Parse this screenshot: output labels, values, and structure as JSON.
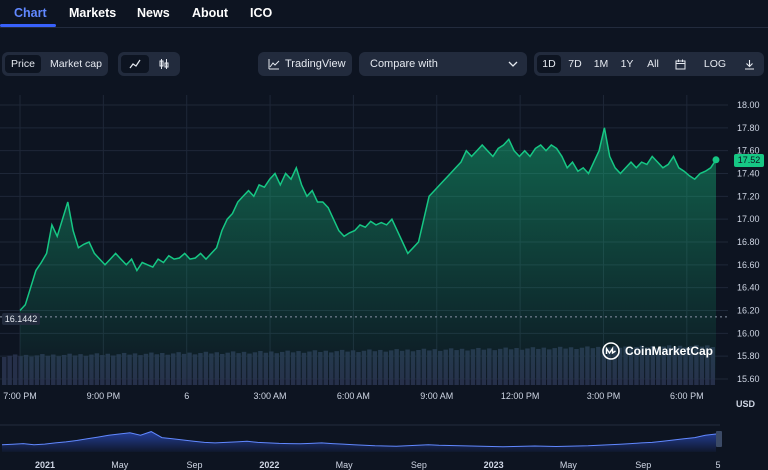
{
  "nav": {
    "tabs": [
      {
        "label": "Chart",
        "active": true
      },
      {
        "label": "Markets",
        "active": false
      },
      {
        "label": "News",
        "active": false
      },
      {
        "label": "About",
        "active": false
      },
      {
        "label": "ICO",
        "active": false
      }
    ]
  },
  "toolbar": {
    "price_label": "Price",
    "marketcap_label": "Market cap",
    "line_chart_icon": "line-chart-icon",
    "candles_icon": "candlestick-icon",
    "tradingview_label": "TradingView",
    "compare_label": "Compare with",
    "ranges": [
      "1D",
      "7D",
      "1M",
      "1Y",
      "All"
    ],
    "selected_range": "1D",
    "calendar_icon": "calendar-icon",
    "log_label": "LOG",
    "download_icon": "download-icon"
  },
  "colors": {
    "background": "#0d1421",
    "accent": "#3861fb",
    "positive": "#16c784",
    "panel": "#222b3d"
  },
  "current_price_badge": "17.52",
  "open_price_badge": "16.1442",
  "watermark": "CoinMarketCap",
  "currency": "USD",
  "chart_data": {
    "type": "line",
    "ylim": [
      15.6,
      18.0
    ],
    "y_ticks": [
      "18.00",
      "17.80",
      "17.60",
      "17.40",
      "17.20",
      "17.00",
      "16.80",
      "16.60",
      "16.40",
      "16.20",
      "16.00",
      "15.80",
      "15.60"
    ],
    "x_ticks": [
      "7:00 PM",
      "9:00 PM",
      "6",
      "3:00 AM",
      "6:00 AM",
      "9:00 AM",
      "12:00 PM",
      "3:00 PM",
      "6:00 PM"
    ],
    "grid": true,
    "reference_line": 16.1442,
    "price": [
      16.2,
      16.25,
      16.4,
      16.55,
      16.62,
      16.7,
      16.95,
      16.85,
      17.0,
      17.15,
      16.9,
      16.75,
      16.78,
      16.8,
      16.7,
      16.65,
      16.6,
      16.65,
      16.7,
      16.65,
      16.6,
      16.65,
      16.55,
      16.62,
      16.6,
      16.58,
      16.65,
      16.62,
      16.68,
      16.65,
      16.66,
      16.7,
      16.65,
      16.66,
      16.7,
      16.65,
      16.7,
      16.75,
      16.9,
      17.0,
      17.05,
      17.15,
      17.2,
      17.25,
      17.2,
      17.3,
      17.28,
      17.35,
      17.4,
      17.3,
      17.4,
      17.35,
      17.45,
      17.3,
      17.2,
      17.25,
      17.15,
      17.15,
      17.1,
      17.0,
      16.9,
      16.85,
      16.88,
      16.9,
      16.95,
      16.93,
      16.98,
      16.95,
      16.97,
      16.95,
      17.0,
      16.9,
      16.8,
      16.7,
      16.75,
      16.8,
      17.0,
      17.2,
      17.25,
      17.3,
      17.35,
      17.4,
      17.45,
      17.5,
      17.6,
      17.55,
      17.6,
      17.65,
      17.6,
      17.55,
      17.62,
      17.65,
      17.7,
      17.6,
      17.55,
      17.6,
      17.55,
      17.62,
      17.65,
      17.6,
      17.65,
      17.62,
      17.55,
      17.45,
      17.5,
      17.42,
      17.45,
      17.4,
      17.5,
      17.6,
      17.8,
      17.55,
      17.45,
      17.4,
      17.45,
      17.5,
      17.45,
      17.5,
      17.48,
      17.55,
      17.5,
      17.45,
      17.48,
      17.55,
      17.45,
      17.42,
      17.38,
      17.35,
      17.4,
      17.42,
      17.45,
      17.52
    ],
    "volume_bars": 131,
    "timeline": {
      "labels": [
        "2021",
        "May",
        "Sep",
        "2022",
        "May",
        "Sep",
        "2023",
        "May",
        "Sep",
        "5"
      ],
      "values": [
        0.3,
        0.32,
        0.35,
        0.3,
        0.33,
        0.38,
        0.42,
        0.48,
        0.55,
        0.62,
        0.7,
        0.75,
        0.8,
        0.7,
        0.85,
        0.6,
        0.55,
        0.5,
        0.45,
        0.4,
        0.38,
        0.4,
        0.42,
        0.45,
        0.4,
        0.38,
        0.36,
        0.35,
        0.34,
        0.36,
        0.38,
        0.35,
        0.33,
        0.3,
        0.28,
        0.26,
        0.25,
        0.24,
        0.26,
        0.28,
        0.3,
        0.28,
        0.27,
        0.26,
        0.25,
        0.24,
        0.23,
        0.22,
        0.23,
        0.24,
        0.25,
        0.24,
        0.23,
        0.24,
        0.25,
        0.26,
        0.28,
        0.3,
        0.32,
        0.35,
        0.38,
        0.4,
        0.45,
        0.5,
        0.55,
        0.6,
        0.7,
        0.75
      ]
    }
  }
}
